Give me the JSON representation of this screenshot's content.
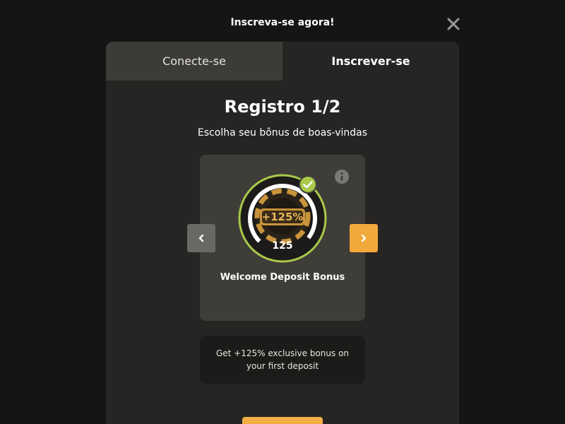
{
  "header": {
    "title": "Inscreva-se agora!",
    "close_icon": "close-icon"
  },
  "tabs": [
    {
      "label": "Conecte-se",
      "active": false
    },
    {
      "label": "Inscrever-se",
      "active": true
    }
  ],
  "registration": {
    "title": "Registro 1/2",
    "subtitle": "Escolha seu bônus de boas-vindas"
  },
  "bonus": {
    "chip_label": "+125%",
    "chip_value": "125",
    "name": "Welcome Deposit Bonus",
    "selected": true,
    "description": "Get +125% exclusive bonus on your first deposit"
  },
  "icons": {
    "info": "info-icon",
    "check": "check-icon",
    "prev": "chevron-left-icon",
    "next": "chevron-right-icon"
  },
  "colors": {
    "background": "#151515",
    "modal": "#262523",
    "card": "#3f3d38",
    "accent_orange": "#f2a93b",
    "accent_green": "#a8c94a",
    "chip_gold": "#c9943a"
  }
}
